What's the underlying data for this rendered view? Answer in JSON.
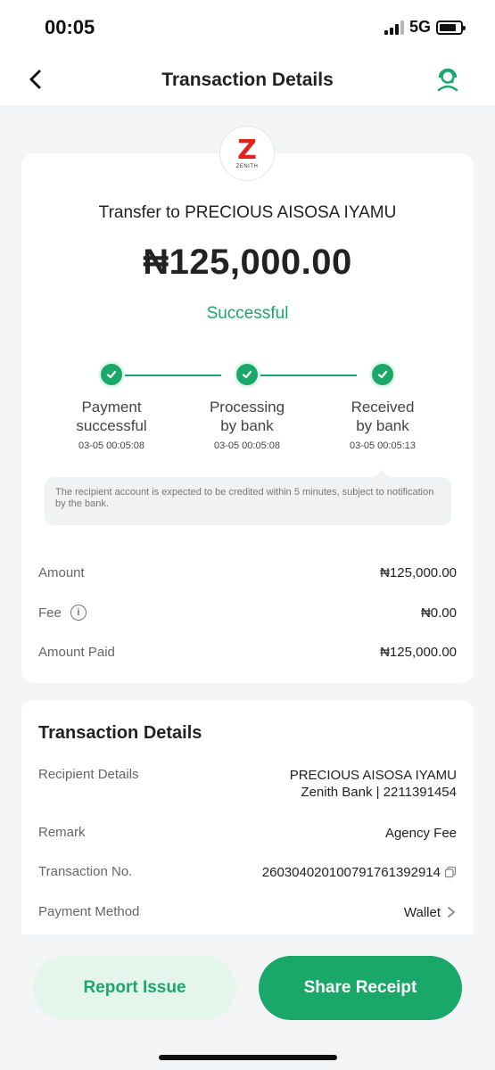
{
  "status_bar": {
    "time": "00:05",
    "network": "5G"
  },
  "nav": {
    "title": "Transaction Details"
  },
  "bank": {
    "logo_text": "ZENITH",
    "logo_letter": "Z"
  },
  "summary": {
    "title": "Transfer to PRECIOUS AISOSA IYAMU",
    "amount": "₦125,000.00",
    "status": "Successful",
    "steps": [
      {
        "label_line1": "Payment",
        "label_line2": "successful",
        "time": "03-05 00:05:08"
      },
      {
        "label_line1": "Processing",
        "label_line2": "by bank",
        "time": "03-05 00:05:08"
      },
      {
        "label_line1": "Received",
        "label_line2": "by bank",
        "time": "03-05 00:05:13"
      }
    ],
    "notice": "The recipient account is expected to be credited within 5 minutes, subject to notification by the bank.",
    "rows": [
      {
        "label": "Amount",
        "value": "₦125,000.00"
      },
      {
        "label": "Fee",
        "value": "₦0.00"
      },
      {
        "label": "Amount Paid",
        "value": "₦125,000.00"
      }
    ]
  },
  "details": {
    "heading": "Transaction Details",
    "recipient_label": "Recipient Details",
    "recipient_name": "PRECIOUS AISOSA IYAMU",
    "recipient_bank": "Zenith Bank | 2211391454",
    "remark_label": "Remark",
    "remark_value": "Agency Fee",
    "txn_label": "Transaction No.",
    "txn_value": "260304020100791761392914",
    "method_label": "Payment Method",
    "method_value": "Wallet"
  },
  "actions": {
    "report": "Report Issue",
    "share": "Share Receipt"
  },
  "colors": {
    "accent": "#1aa86a",
    "accent_light": "#e4f5ec",
    "zenith_red": "#e2231a"
  }
}
